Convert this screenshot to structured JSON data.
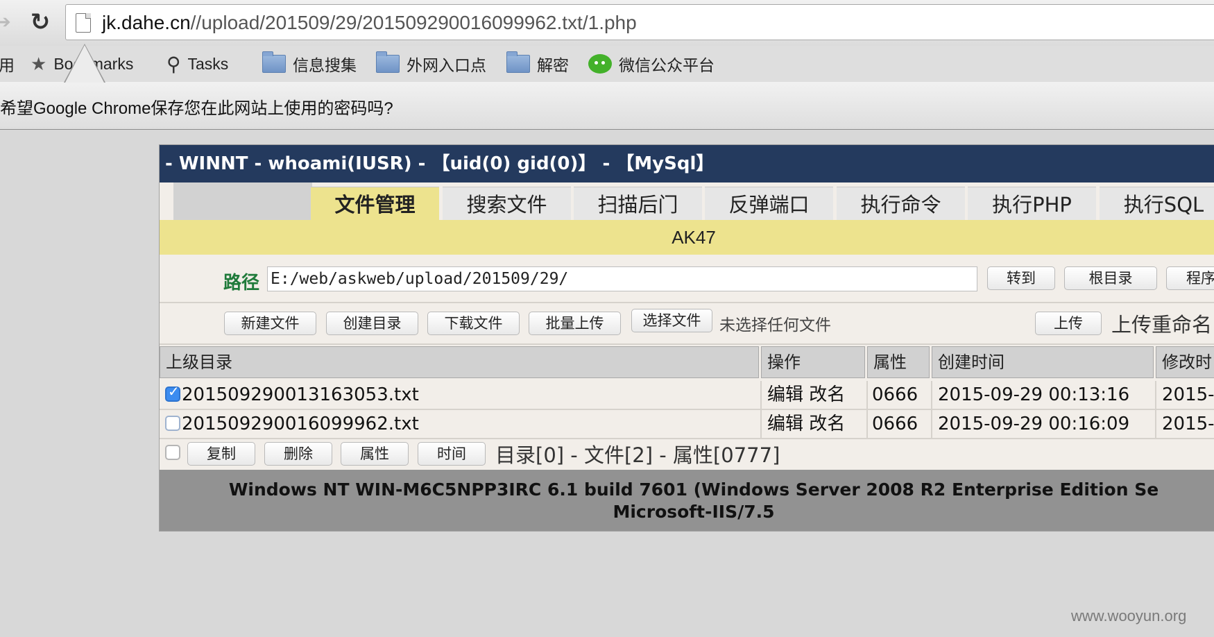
{
  "browser": {
    "url_host": "jk.dahe.cn",
    "url_path": "//upload/201509/29/201509290016099962.txt/1.php",
    "bookmarks": [
      {
        "label": "用",
        "icon": "apps-icon"
      },
      {
        "label": "Bookmarks",
        "icon": "star-icon"
      },
      {
        "label": "Tasks",
        "icon": "search-icon"
      },
      {
        "label": "信息搜集",
        "icon": "folder-icon"
      },
      {
        "label": "外网入口点",
        "icon": "folder-icon"
      },
      {
        "label": "解密",
        "icon": "folder-icon"
      },
      {
        "label": "微信公众平台",
        "icon": "wechat-icon"
      }
    ],
    "infobar_text": "希望Google Chrome保存您在此网站上使用的密码吗?"
  },
  "shell": {
    "title": "- WINNT - whoami(IUSR) - 【uid(0) gid(0)】 - 【MySql】",
    "tabs": [
      "文件管理",
      "搜索文件",
      "扫描后门",
      "反弹端口",
      "执行命令",
      "执行PHP",
      "执行SQL"
    ],
    "active_tab": "文件管理",
    "banner": "AK47",
    "path_label": "路径",
    "path_value": "E:/web/askweb/upload/201509/29/",
    "path_buttons": [
      "转到",
      "根目录",
      "程序"
    ],
    "toolbar_buttons": [
      "新建文件",
      "创建目录",
      "下载文件",
      "批量上传"
    ],
    "choose_file": "选择文件",
    "no_file": "未选择任何文件",
    "upload": "上传",
    "upload_rename": "上传重命名",
    "columns": [
      "上级目录",
      "操作",
      "属性",
      "创建时间",
      "修改时"
    ],
    "files": [
      {
        "name": "201509290013163053.txt",
        "ops": "编辑 改名",
        "attr": "0666",
        "created": "2015-09-29 00:13:16",
        "modified": "2015-",
        "checked": true
      },
      {
        "name": "201509290016099962.txt",
        "ops": "编辑 改名",
        "attr": "0666",
        "created": "2015-09-29 00:16:09",
        "modified": "2015-",
        "checked": false
      }
    ],
    "bulk_buttons": [
      "复制",
      "删除",
      "属性",
      "时间"
    ],
    "summary": "目录[0] - 文件[2] - 属性[0777]",
    "footer_line1": "Windows NT WIN-M6C5NPP3IRC 6.1 build 7601 (Windows Server 2008 R2 Enterprise Edition Se",
    "footer_line2": "Microsoft-IIS/7.5"
  },
  "watermark": "www.wooyun.org"
}
